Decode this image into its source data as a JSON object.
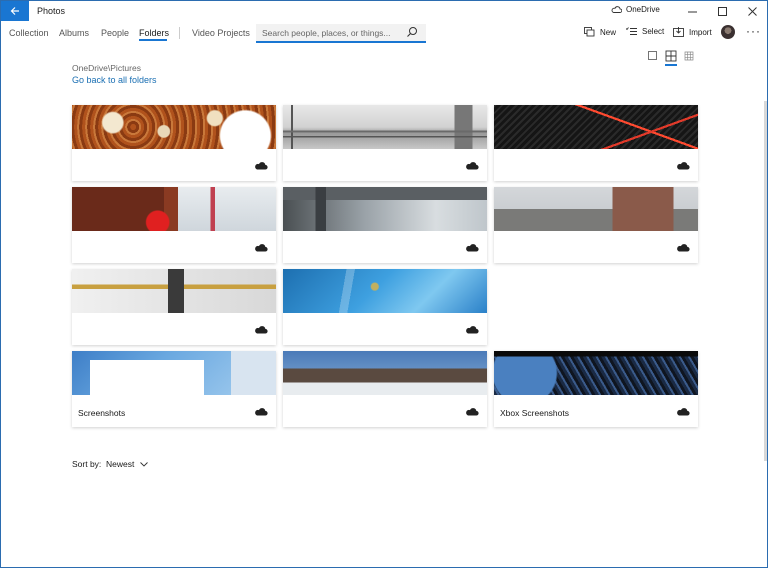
{
  "app": {
    "title": "Photos",
    "onedrive_label": "OneDrive"
  },
  "nav": {
    "tabs": [
      {
        "label": "Collection",
        "active": false
      },
      {
        "label": "Albums",
        "active": false
      },
      {
        "label": "People",
        "active": false
      },
      {
        "label": "Folders",
        "active": true
      },
      {
        "label": "Video Projects",
        "active": false
      }
    ],
    "search_placeholder": "Search people, places, or things..."
  },
  "commands": {
    "new_label": "New",
    "select_label": "Select",
    "import_label": "Import"
  },
  "breadcrumb": {
    "path": "OneDrive\\Pictures",
    "back_link": "Go back to all folders"
  },
  "folders": [
    {
      "label": "",
      "theme": "pizza"
    },
    {
      "label": "",
      "theme": "rail"
    },
    {
      "label": "",
      "theme": "red-neon"
    },
    {
      "label": "",
      "theme": "buildings"
    },
    {
      "label": "",
      "theme": "station"
    },
    {
      "label": "",
      "theme": "winter-street"
    },
    {
      "label": "",
      "theme": "lego"
    },
    {
      "label": "",
      "theme": "sky-blue"
    },
    {
      "label": "Screenshots",
      "theme": "desktop"
    },
    {
      "label": "",
      "theme": "snow-houses"
    },
    {
      "label": "Xbox Screenshots",
      "theme": "xbox"
    }
  ],
  "sort": {
    "label": "Sort by:",
    "value": "Newest"
  },
  "colors": {
    "accent": "#1976d2",
    "link": "#1a6fb3"
  }
}
